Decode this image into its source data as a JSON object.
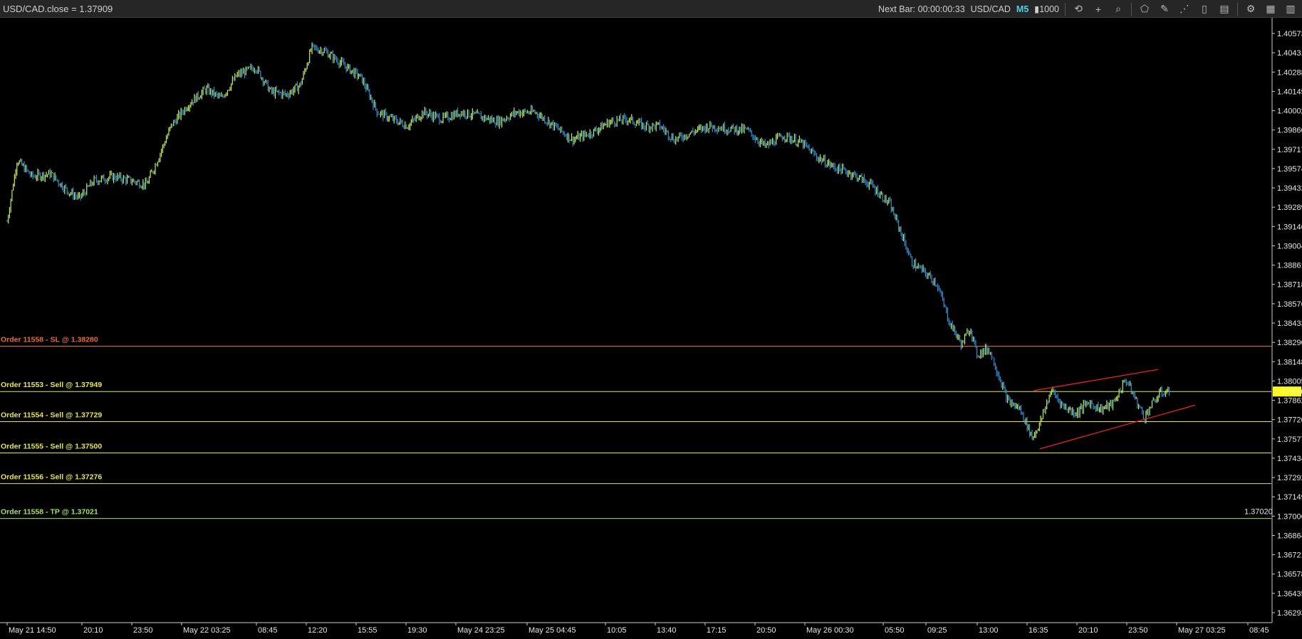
{
  "header": {
    "title": "USD/CAD.close = 1.37909",
    "next_bar": "Next Bar: 00:00:00:33",
    "symbol": "USD/CAD",
    "timeframe": "M5",
    "bar_count": "1000",
    "icons": [
      "history-icon",
      "crosshair-icon",
      "zoom-icon",
      "shape-tool-icon",
      "draw-tool-icon",
      "fib-tool-icon",
      "bookmark-icon",
      "panel-icon",
      "settings-icon",
      "chart-icon"
    ]
  },
  "colors": {
    "background": "#000000",
    "up_candle": "#c6ef5e",
    "down_candle": "#2f8fd8",
    "sl_line": "#e8683a",
    "sell_line": "#e6e64a",
    "tp_line": "#a4e05a",
    "trend_line": "#ee2222",
    "price_box": "#ffff00"
  },
  "chart_data": {
    "type": "candlestick",
    "symbol": "USD/CAD",
    "timeframe": "M5",
    "ylim": [
      1.3622,
      1.4064
    ],
    "y_ticks": [
      "1.40573",
      "1.40431",
      "1.40288",
      "1.40145",
      "1.40002",
      "1.39860",
      "1.39717",
      "1.39574",
      "1.39432",
      "1.39289",
      "1.39146",
      "1.39004",
      "1.38861",
      "1.38718",
      "1.38576",
      "1.38433",
      "1.38290",
      "1.38148",
      "1.38005",
      "1.37862",
      "1.37720",
      "1.37577",
      "1.37434",
      "1.37292",
      "1.37149",
      "1.37006",
      "1.36864",
      "1.36721",
      "1.36578",
      "1.36435",
      "1.36293"
    ],
    "x_ticks": [
      "May 21 14:50",
      "20:10",
      "23:50",
      "May 22 03:25",
      "08:45",
      "12:20",
      "15:55",
      "19:30",
      "May 24 23:25",
      "May 25 04:45",
      "10:05",
      "13:40",
      "17:15",
      "20:50",
      "May 26 00:30",
      "05:50",
      "09:25",
      "13:00",
      "16:35",
      "20:10",
      "23:50",
      "May 27 03:25",
      "08:45"
    ],
    "current_price": "1.37909",
    "price_path": [
      [
        0,
        1.3915
      ],
      [
        0.008,
        1.396
      ],
      [
        0.02,
        1.3948
      ],
      [
        0.035,
        1.395
      ],
      [
        0.048,
        1.3938
      ],
      [
        0.058,
        1.3932
      ],
      [
        0.07,
        1.3945
      ],
      [
        0.085,
        1.3948
      ],
      [
        0.1,
        1.3945
      ],
      [
        0.112,
        1.3942
      ],
      [
        0.12,
        1.3958
      ],
      [
        0.132,
        1.3985
      ],
      [
        0.145,
        1.4
      ],
      [
        0.16,
        1.4012
      ],
      [
        0.172,
        1.4005
      ],
      [
        0.185,
        1.4022
      ],
      [
        0.2,
        1.4028
      ],
      [
        0.212,
        1.401
      ],
      [
        0.225,
        1.4008
      ],
      [
        0.236,
        1.4015
      ],
      [
        0.245,
        1.4042
      ],
      [
        0.255,
        1.404
      ],
      [
        0.27,
        1.403
      ],
      [
        0.285,
        1.402
      ],
      [
        0.298,
        1.3995
      ],
      [
        0.31,
        1.399
      ],
      [
        0.322,
        1.3985
      ],
      [
        0.335,
        1.3995
      ],
      [
        0.35,
        1.399
      ],
      [
        0.365,
        1.3995
      ],
      [
        0.38,
        1.3992
      ],
      [
        0.395,
        1.3988
      ],
      [
        0.41,
        1.3995
      ],
      [
        0.425,
        1.3995
      ],
      [
        0.44,
        1.3985
      ],
      [
        0.455,
        1.3975
      ],
      [
        0.47,
        1.398
      ],
      [
        0.485,
        1.3988
      ],
      [
        0.5,
        1.399
      ],
      [
        0.512,
        1.3985
      ],
      [
        0.525,
        1.3985
      ],
      [
        0.537,
        1.3975
      ],
      [
        0.55,
        1.398
      ],
      [
        0.565,
        1.3985
      ],
      [
        0.58,
        1.3983
      ],
      [
        0.595,
        1.3982
      ],
      [
        0.61,
        1.397
      ],
      [
        0.625,
        1.3978
      ],
      [
        0.64,
        1.3972
      ],
      [
        0.652,
        1.3962
      ],
      [
        0.665,
        1.3955
      ],
      [
        0.68,
        1.395
      ],
      [
        0.695,
        1.3942
      ],
      [
        0.71,
        1.3928
      ],
      [
        0.718,
        1.391
      ],
      [
        0.728,
        1.3885
      ],
      [
        0.738,
        1.3878
      ],
      [
        0.748,
        1.387
      ],
      [
        0.758,
        1.3842
      ],
      [
        0.768,
        1.3825
      ],
      [
        0.775,
        1.3838
      ],
      [
        0.78,
        1.3818
      ],
      [
        0.79,
        1.3822
      ],
      [
        0.797,
        1.3805
      ],
      [
        0.805,
        1.3784
      ],
      [
        0.815,
        1.3778
      ],
      [
        0.825,
        1.3757
      ],
      [
        0.832,
        1.377
      ],
      [
        0.84,
        1.3792
      ],
      [
        0.85,
        1.378
      ],
      [
        0.86,
        1.3775
      ],
      [
        0.87,
        1.3783
      ],
      [
        0.88,
        1.3778
      ],
      [
        0.89,
        1.3782
      ],
      [
        0.9,
        1.38
      ],
      [
        0.908,
        1.3785
      ],
      [
        0.915,
        1.3772
      ],
      [
        0.92,
        1.378
      ],
      [
        0.928,
        1.379
      ],
      [
        0.935,
        1.3791
      ]
    ],
    "orders": [
      {
        "label": "Order 11558 - SL @ 1.38280",
        "price": 1.3824,
        "kind": "sl"
      },
      {
        "label": "Order 11553 - Sell @ 1.37949",
        "price": 1.37909,
        "kind": "sell"
      },
      {
        "label": "Order 11554 - Sell @ 1.37729",
        "price": 1.37689,
        "kind": "sell"
      },
      {
        "label": "Order 11555 - Sell @ 1.37500",
        "price": 1.3746,
        "kind": "sell"
      },
      {
        "label": "Order 11556 - Sell @ 1.37276",
        "price": 1.37236,
        "kind": "sell"
      },
      {
        "label": "Order 11558 - TP @ 1.37021",
        "price": 1.36981,
        "kind": "tp"
      }
    ],
    "tp_price_label": "1.37020",
    "channel_lines": [
      {
        "from": [
          0.826,
          1.37915
        ],
        "to": [
          0.926,
          1.3807
        ]
      },
      {
        "from": [
          0.831,
          1.3749
        ],
        "to": [
          0.956,
          1.3781
        ]
      }
    ]
  }
}
